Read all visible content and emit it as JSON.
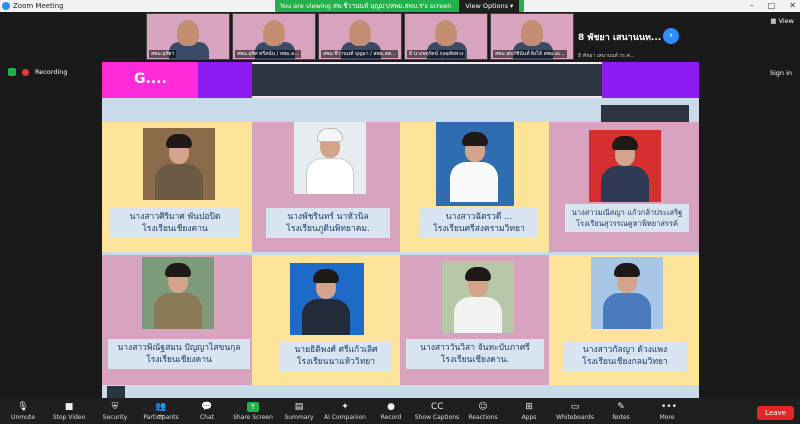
{
  "window": {
    "title": "Zoom Meeting"
  },
  "banner": {
    "viewing": "You are viewing สพ.ชีวานนท์ บุญมา/สพม.ลพบ.ร's screen",
    "options": "View Options"
  },
  "thumbnails": [
    {
      "caption": "สพม.อุทัยฯ"
    },
    {
      "caption": "สพม.อุทิศ ศรีสนั่น / สพม.ล..."
    },
    {
      "caption": "สพม.ชีวานนท์ บุญมา / สพม.ลพ..."
    },
    {
      "caption": "8 นางจตุรัตน์ กุลอุทัยพวง"
    },
    {
      "caption": "สพม.สุขภัชินันท์ ผิงไธ์ สพม.อะ..."
    }
  ],
  "active_speaker": {
    "name": "8 พัชยา เสนานนท์ รร.ค่...",
    "short": "8 พัชยา เสนานนท..."
  },
  "view_label": "View",
  "recording_label": "Recording",
  "signin_label": "Sign in",
  "slide": {
    "header": "G....",
    "cards": [
      {
        "line1": "นางสาวศิริมาศ พันปอปิด",
        "line2": "โรงเรียนเชียงคาน"
      },
      {
        "line1": "นางพัชรินทร์ นาหัวนิล",
        "line2": "โรงเรียนภูดินพิทยาคม."
      },
      {
        "line1": "นางสาวฉัตรวดี ...",
        "line2": "โรงเรียนศรีสงครามวิทยา"
      },
      {
        "line1": "นางสาวมณีสญา แก้วกล้าประเสริฐ",
        "line2": "โรงเรียนสุวรรณคูหาพิทยาสรรค์"
      },
      {
        "line1": "นางสาวพิณัฐสมน ปัญญาไสขนกุล",
        "line2": "โรงเรียนเชียงคาน"
      },
      {
        "line1": "นายธิติพงศ์ ศรีแก้วเลิศ",
        "line2": "โรงเรียนนาแห้ววิทยา"
      },
      {
        "line1": "นางสาววันวิสา จันทะบับภาศรี",
        "line2": "โรงเรียนเชียงคาน."
      },
      {
        "line1": "นางสาวกัลญา ด้วงแพง",
        "line2": "โรงเรียนเชียงกลมวิทยา"
      }
    ]
  },
  "toolbar": {
    "items": [
      {
        "label": "Unmute",
        "icon": "mic-off-icon"
      },
      {
        "label": "Stop Video",
        "icon": "video-icon"
      },
      {
        "label": "Security",
        "icon": "shield-icon"
      },
      {
        "label": "Participants",
        "icon": "participants-icon",
        "count": "77"
      },
      {
        "label": "Chat",
        "icon": "chat-icon"
      },
      {
        "label": "Share Screen",
        "icon": "share-icon"
      },
      {
        "label": "Summary",
        "icon": "summary-icon"
      },
      {
        "label": "AI Companion",
        "icon": "ai-icon"
      },
      {
        "label": "Record",
        "icon": "record-icon"
      },
      {
        "label": "Show Captions",
        "icon": "cc-icon"
      },
      {
        "label": "Reactions",
        "icon": "reactions-icon"
      },
      {
        "label": "Apps",
        "icon": "apps-icon"
      },
      {
        "label": "Whiteboards",
        "icon": "whiteboard-icon"
      },
      {
        "label": "Notes",
        "icon": "notes-icon"
      },
      {
        "label": "More",
        "icon": "more-icon"
      }
    ],
    "leave": "Leave"
  },
  "colors": {
    "accent": "#2d8cff",
    "magenta": "#ff2bd8",
    "purple": "#8e1cf2",
    "green": "#23b14d",
    "leave": "#e02828"
  }
}
